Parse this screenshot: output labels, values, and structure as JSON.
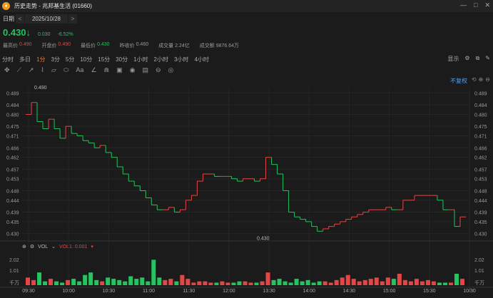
{
  "window": {
    "title": "历史走势 - 兆邦基生活 (01660)",
    "logo": "logo-icon",
    "controls": [
      "—",
      "□",
      "✕"
    ]
  },
  "date_row": {
    "label": "日期",
    "prev": "<",
    "date": "2025/10/28",
    "next": ">"
  },
  "quote": {
    "price": "0.430",
    "change": "0.030",
    "change_pct": "-6.52%"
  },
  "stats": [
    {
      "label": "最高价",
      "value": "0.490",
      "color": "#e64545"
    },
    {
      "label": "开盘价",
      "value": "0.490",
      "color": "#e64545"
    },
    {
      "label": "最低价",
      "value": "0.430",
      "color": "#22c55e"
    },
    {
      "label": "昨收价",
      "value": "0.460",
      "color": "#9a9a9a"
    },
    {
      "label": "成交量",
      "value": "2.24亿",
      "color": "#9a9a9a"
    },
    {
      "label": "成交额",
      "value": "9876.64万",
      "color": "#9a9a9a"
    }
  ],
  "periods": [
    "分时",
    "多日",
    "1分",
    "3分",
    "5分",
    "10分",
    "15分",
    "30分",
    "1小时",
    "2小时",
    "3小时",
    "4小时"
  ],
  "active_period": "1分",
  "right_tools": {
    "display": "显示"
  },
  "adjust": "不复权",
  "volume": {
    "label": "VOL",
    "indicator": "VOL1: 0.001",
    "y_labels": [
      "2.02",
      "1.01",
      "千万"
    ]
  },
  "chart_data": {
    "type": "line",
    "title": "",
    "xlabel": "",
    "ylabel": "",
    "y_ticks": [
      0.489,
      0.484,
      0.48,
      0.475,
      0.471,
      0.466,
      0.462,
      0.457,
      0.453,
      0.448,
      0.444,
      0.439,
      0.435,
      0.43
    ],
    "y_tick_labels": [
      "0.489",
      "0.484",
      "0.480",
      "0.475",
      "0.471",
      "0.466",
      "0.462",
      "0.457",
      "0.453",
      "0.448",
      "0.444",
      "0.439",
      "0.435",
      "0.430"
    ],
    "ylim": [
      0.4275,
      0.4915
    ],
    "x_labels": [
      "09:30",
      "10:00",
      "10:30",
      "11:00",
      "11:30",
      "12:00",
      "13:30",
      "14:00",
      "14:30",
      "15:00",
      "15:30",
      "10/30"
    ],
    "annotations": [
      {
        "text": "0.490",
        "time": "09:30",
        "value": 0.49
      },
      {
        "text": "0.430",
        "time": "13:00",
        "value": 0.43
      }
    ],
    "up_color": "#e64545",
    "down_color": "#22c55e",
    "series": [
      {
        "values": [
          0.48,
          0.485,
          0.477,
          0.474,
          0.478,
          0.474,
          0.47,
          0.475,
          0.472,
          0.471,
          0.469,
          0.468,
          0.466,
          0.467,
          0.464,
          0.462,
          0.458,
          0.455,
          0.452,
          0.45,
          0.448,
          0.445,
          0.442,
          0.44,
          0.44,
          0.441,
          0.439,
          0.44,
          0.444,
          0.446,
          0.452,
          0.455,
          0.455,
          0.454,
          0.454,
          0.454,
          0.453,
          0.452,
          0.453,
          0.453,
          0.452,
          0.453,
          0.462,
          0.459,
          0.455,
          0.448,
          0.439,
          0.437,
          0.436,
          0.435,
          0.433,
          0.431,
          0.432,
          0.433,
          0.434,
          0.435,
          0.436,
          0.437,
          0.438,
          0.439,
          0.44,
          0.44,
          0.44,
          0.441,
          0.44,
          0.44,
          0.444,
          0.444,
          0.446,
          0.446,
          0.446,
          0.446,
          0.444,
          0.44,
          0.44,
          0.433,
          0.437
        ]
      }
    ],
    "volume_values": [
      0.6,
      0.4,
      1.0,
      0.3,
      0.5,
      0.3,
      0.2,
      0.4,
      0.5,
      0.3,
      0.8,
      1.0,
      0.4,
      0.3,
      0.6,
      0.5,
      0.4,
      0.3,
      0.7,
      0.5,
      0.6,
      0.3,
      2.0,
      0.6,
      0.4,
      0.5,
      0.3,
      0.8,
      0.5,
      0.2,
      0.3,
      0.3,
      0.2,
      0.2,
      0.3,
      0.2,
      0.2,
      0.3,
      0.3,
      0.2,
      0.2,
      0.3,
      1.0,
      0.4,
      0.5,
      0.3,
      0.2,
      0.5,
      0.3,
      0.4,
      0.2,
      0.3,
      0.3,
      0.2,
      0.4,
      0.6,
      0.8,
      0.5,
      0.3,
      0.4,
      0.5,
      0.6,
      0.3,
      0.6,
      0.5,
      0.9,
      0.4,
      0.3,
      0.5,
      0.3,
      0.4,
      0.3,
      0.2,
      0.2,
      0.2,
      0.9,
      0.5
    ]
  }
}
